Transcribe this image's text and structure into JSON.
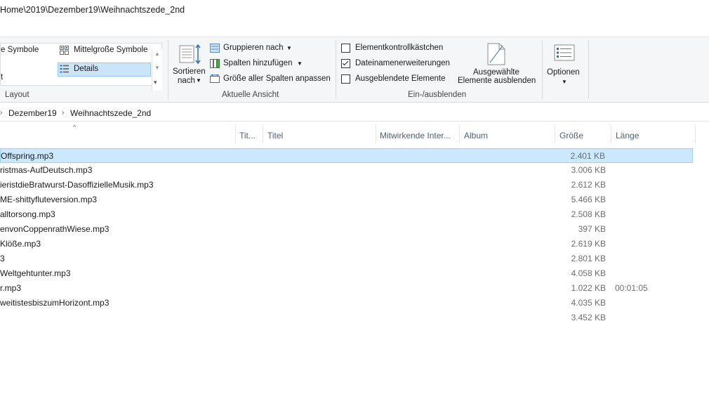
{
  "window": {
    "path": "Home\\2019\\Dezember19\\Weihnachtszede_2nd"
  },
  "ribbon": {
    "layout": {
      "large_icons": "e Symbole",
      "medium_icons": "Mittelgroße Symbole",
      "details": "Details",
      "small_item": "t",
      "group_label": "Layout"
    },
    "current_view": {
      "sort_label_1": "Sortieren",
      "sort_label_2": "nach",
      "group_by": "Gruppieren nach",
      "add_columns": "Spalten hinzufügen",
      "fit_columns": "Größe aller Spalten anpassen",
      "group_label": "Aktuelle Ansicht"
    },
    "show_hide": {
      "item_checkboxes": "Elementkontrollkästchen",
      "item_checkboxes_checked": false,
      "file_extensions": "Dateinamenerweiterungen",
      "file_extensions_checked": true,
      "hidden_items": "Ausgeblendete Elemente",
      "hidden_items_checked": false,
      "hide_selected_1": "Ausgewählte",
      "hide_selected_2": "Elemente ausblenden",
      "group_label": "Ein-/ausblenden"
    },
    "options": {
      "label": "Optionen"
    }
  },
  "address": {
    "crumbs": [
      "Dezember19",
      "Weihnachtszede_2nd"
    ]
  },
  "columns": {
    "title_short": "Tit...",
    "title": "Titel",
    "artists": "Mitwirkende Inter...",
    "album": "Album",
    "size": "Größe",
    "length": "Länge"
  },
  "files": [
    {
      "name": "Offspring.mp3",
      "size": "2.401 KB",
      "length": "",
      "selected": true
    },
    {
      "name": "ristmas-AufDeutsch.mp3",
      "size": "3.006 KB",
      "length": ""
    },
    {
      "name": "ieristdieBratwurst-DasoffizielleMusik.mp3",
      "size": "2.612 KB",
      "length": ""
    },
    {
      "name": "ME-shittyfluteversion.mp3",
      "size": "5.466 KB",
      "length": ""
    },
    {
      "name": "alltorsong.mp3",
      "size": "2.508 KB",
      "length": ""
    },
    {
      "name": "envonCoppenrathWiese.mp3",
      "size": "397 KB",
      "length": ""
    },
    {
      "name": "Klöße.mp3",
      "size": "2.619 KB",
      "length": ""
    },
    {
      "name": "3",
      "size": "2.801 KB",
      "length": ""
    },
    {
      "name": "Weltgehtunter.mp3",
      "size": "4.058 KB",
      "length": ""
    },
    {
      "name": "r.mp3",
      "size": "1.022 KB",
      "length": "00:01:05"
    },
    {
      "name": "weitistesbiszumHorizont.mp3",
      "size": "4.035 KB",
      "length": ""
    },
    {
      "name": "",
      "size": "3.452 KB",
      "length": ""
    }
  ]
}
